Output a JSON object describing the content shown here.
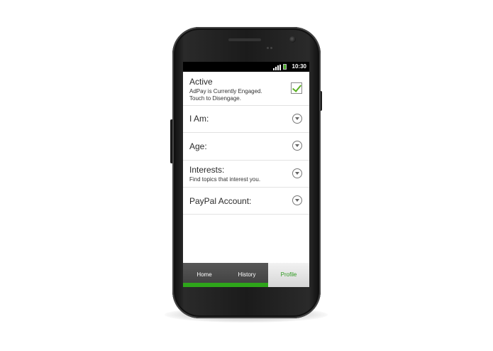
{
  "status_bar": {
    "time": "10:30"
  },
  "settings": {
    "active": {
      "title": "Active",
      "subtitle_line1": "AdPay is Currently Engaged.",
      "subtitle_line2": "Touch to Disengage.",
      "checked": true
    },
    "i_am": {
      "title": "I Am:"
    },
    "age": {
      "title": "Age:"
    },
    "interests": {
      "title": "Interests:",
      "subtitle": "Find topics that interest you."
    },
    "paypal": {
      "title": "PayPal Account:"
    }
  },
  "tabs": [
    {
      "label": "Home"
    },
    {
      "label": "History"
    },
    {
      "label": "Profile",
      "selected": true
    }
  ],
  "colors": {
    "accent_green": "#2ea51a",
    "check_green": "#5bb022"
  },
  "icons": [
    "signal-icon",
    "battery-icon",
    "checkmark-icon",
    "chevron-down-icon"
  ]
}
